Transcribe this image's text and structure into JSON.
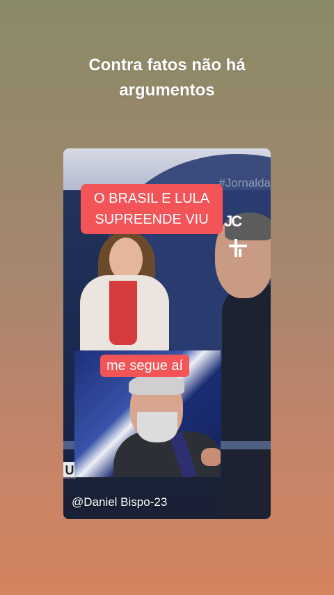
{
  "post": {
    "caption": "Contra fatos não há\nargumentos"
  },
  "video": {
    "hashtag": "#Jornalda",
    "top_banner": "O BRASIL E LULA\nSUPREENDE VIU",
    "logo_jc": "JC",
    "logo_tv": "╬",
    "screen_letters": "U",
    "inset_label": "me segue aí",
    "watermark": "@Daniel Bispo-23"
  },
  "colors": {
    "banner_red": "#f25458",
    "studio_blue": "#25355f"
  }
}
